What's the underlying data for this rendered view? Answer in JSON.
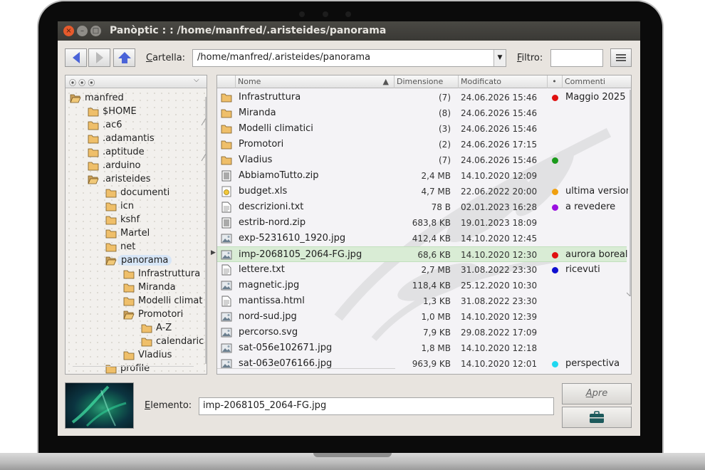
{
  "window": {
    "title": "Panòptic  : :  /home/manfred/.aristeides/panorama",
    "close_glyph": "×",
    "min_glyph": "–",
    "max_glyph": "□"
  },
  "toolbar": {
    "back_icon": "arrow-left-icon",
    "forward_icon": "arrow-right-icon",
    "up_icon": "arrow-up-icon",
    "folder_label_u": "C",
    "folder_label_rest": "artella:",
    "path_value": "/home/manfred/.aristeides/panorama",
    "filter_label_u": "F",
    "filter_label_rest": "iltro:",
    "filter_value": ""
  },
  "tree": {
    "header_dots": "⦿ ⦿ ⦿",
    "items": [
      {
        "label": "manfred",
        "open": true
      },
      {
        "label": "$HOME",
        "open": false
      },
      {
        "label": ".ac6",
        "open": false
      },
      {
        "label": ".adamantis",
        "open": false
      },
      {
        "label": ".aptitude",
        "open": false
      },
      {
        "label": ".arduino",
        "open": false
      },
      {
        "label": ".aristeides",
        "open": true
      },
      {
        "label": "documenti",
        "open": false
      },
      {
        "label": "icn",
        "open": false
      },
      {
        "label": "kshf",
        "open": false
      },
      {
        "label": "Martel",
        "open": false
      },
      {
        "label": "net",
        "open": false
      },
      {
        "label": "panorama",
        "open": true,
        "selected": true
      },
      {
        "label": "Infrastruttura",
        "open": false
      },
      {
        "label": "Miranda",
        "open": false
      },
      {
        "label": "Modelli climat",
        "open": false
      },
      {
        "label": "Promotori",
        "open": true
      },
      {
        "label": "A-Z",
        "open": false
      },
      {
        "label": "calendaric",
        "open": false
      },
      {
        "label": "Vladius",
        "open": false
      },
      {
        "label": "profile",
        "open": false
      }
    ]
  },
  "list": {
    "columns": [
      "Nome",
      "Dimensione",
      "Modificato",
      "•",
      "Commenti"
    ],
    "rows": [
      {
        "name": "Infrastruttura",
        "type": "folder",
        "size": "(7)",
        "date": "24.06.2026 15:46",
        "dot": "#e01010",
        "comment": "Maggio 2025"
      },
      {
        "name": "Miranda",
        "type": "folder",
        "size": "(8)",
        "date": "24.06.2026 15:46",
        "dot": "",
        "comment": ""
      },
      {
        "name": "Modelli climatici",
        "type": "folder",
        "size": "(3)",
        "date": "24.06.2026 15:46",
        "dot": "",
        "comment": ""
      },
      {
        "name": "Promotori",
        "type": "folder",
        "size": "(2)",
        "date": "24.06.2026 17:15",
        "dot": "",
        "comment": ""
      },
      {
        "name": "Vladius",
        "type": "folder",
        "size": "(7)",
        "date": "24.06.2026 15:46",
        "dot": "#1a9a1a",
        "comment": ""
      },
      {
        "name": "AbbiamoTutto.zip",
        "type": "zip",
        "size": "2,4 MB",
        "date": "14.10.2020 12:09",
        "dot": "",
        "comment": ""
      },
      {
        "name": "budget.xls",
        "type": "sheet",
        "size": "4,7 MB",
        "date": "22.06.2022 20:00",
        "dot": "#f0a010",
        "comment": "ultima versione"
      },
      {
        "name": "descrizioni.txt",
        "type": "text",
        "size": "78 B",
        "date": "02.01.2023 16:28",
        "dot": "#9a10e0",
        "comment": "a revedere"
      },
      {
        "name": "estrib-nord.zip",
        "type": "zip",
        "size": "683,8 KB",
        "date": "19.01.2023 18:09",
        "dot": "",
        "comment": ""
      },
      {
        "name": "exp-5231610_1920.jpg",
        "type": "image",
        "size": "412,4 KB",
        "date": "14.10.2020 12:45",
        "dot": "",
        "comment": ""
      },
      {
        "name": "imp-2068105_2064-FG.jpg",
        "type": "image",
        "size": "68,6 KB",
        "date": "14.10.2020 12:30",
        "dot": "#e01010",
        "comment": "aurora boreale",
        "selected": true
      },
      {
        "name": "lettere.txt",
        "type": "text",
        "size": "2,7 MB",
        "date": "31.08.2022 23:30",
        "dot": "#1010d0",
        "comment": "ricevuti"
      },
      {
        "name": "magnetic.jpg",
        "type": "image",
        "size": "118,4 KB",
        "date": "25.12.2020 10:30",
        "dot": "",
        "comment": ""
      },
      {
        "name": "mantissa.html",
        "type": "text",
        "size": "1,3 KB",
        "date": "31.08.2022 23:30",
        "dot": "",
        "comment": ""
      },
      {
        "name": "nord-sud.jpg",
        "type": "image",
        "size": "1,0 MB",
        "date": "14.10.2020 12:39",
        "dot": "",
        "comment": ""
      },
      {
        "name": "percorso.svg",
        "type": "image",
        "size": "7,9 KB",
        "date": "29.08.2022 17:09",
        "dot": "",
        "comment": ""
      },
      {
        "name": "sat-056e102671.jpg",
        "type": "image",
        "size": "1,8 MB",
        "date": "14.10.2020 12:18",
        "dot": "",
        "comment": ""
      },
      {
        "name": "sat-063e076166.jpg",
        "type": "image",
        "size": "963,9 KB",
        "date": "14.10.2020 12:01",
        "dot": "#20d8f0",
        "comment": "perspectiva"
      }
    ]
  },
  "bottom": {
    "element_label_u": "E",
    "element_label_rest": "lemento:",
    "element_value": "imp-2068105_2064-FG.jpg",
    "open_label_u": "A",
    "open_label_rest": "pre",
    "case_icon": "briefcase-icon"
  },
  "colors": {
    "accent_blue": "#4a63d8",
    "selection_green": "#d9ecd5",
    "tree_selection": "#d7e6f7",
    "titlebar": "#3f3e3a"
  }
}
